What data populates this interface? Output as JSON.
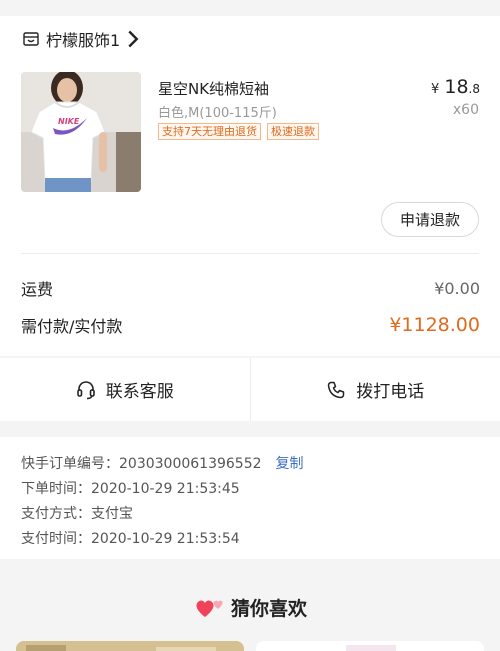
{
  "shop": {
    "name": "柠檬服饰1",
    "icon": "store-icon"
  },
  "product": {
    "title": "星空NK纯棉短袖",
    "spec": "白色,M(100-115斤)",
    "tags": [
      "支持7天无理由退货",
      "极速退款"
    ],
    "price": {
      "currency": "¥",
      "integer": "18",
      "decimal": ".8"
    },
    "quantity": "x60",
    "thumb_logo": "NIKE"
  },
  "actions": {
    "refund_label": "申请退款"
  },
  "summary": {
    "shipping_label": "运费",
    "shipping_value": "¥0.00",
    "pay_label": "需付款/实付款",
    "pay_value": "¥1128.00"
  },
  "contact": {
    "service_label": "联系客服",
    "service_icon": "headset-icon",
    "phone_label": "拨打电话",
    "phone_icon": "phone-icon"
  },
  "order_info": {
    "order_no_label": "快手订单编号：",
    "order_no_value": "2030300061396552",
    "copy_label": "复制",
    "order_time_label": "下单时间：",
    "order_time_value": "2020-10-29 21:53:45",
    "pay_method_label": "支付方式：",
    "pay_method_value": "支付宝",
    "pay_time_label": "支付时间：",
    "pay_time_value": "2020-10-29 21:53:54"
  },
  "recommend": {
    "title": "猜你喜欢",
    "icon": "hearts-icon"
  },
  "colors": {
    "accent": "#e06a1d",
    "link": "#3d6fc0",
    "background": "#f4f4f4"
  }
}
